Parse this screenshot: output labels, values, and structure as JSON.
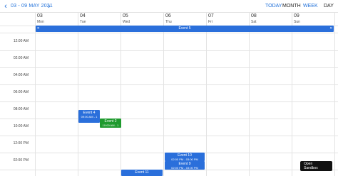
{
  "toolbar": {
    "prev_icon": "chevron-left-icon",
    "next_icon": "chevron-right-icon",
    "range": "03 - 09 MAY 2021",
    "today": "TODAY",
    "month": "MONTH",
    "week": "WEEK",
    "day": "DAY"
  },
  "days": [
    {
      "num": "03",
      "name": "Mon"
    },
    {
      "num": "04",
      "name": "Tue"
    },
    {
      "num": "05",
      "name": "Wed"
    },
    {
      "num": "06",
      "name": "Thu"
    },
    {
      "num": "07",
      "name": "Fri"
    },
    {
      "num": "08",
      "name": "Sat"
    },
    {
      "num": "09",
      "name": "Sun"
    }
  ],
  "allday": {
    "label": "Event 5",
    "left_icon": "chevron-left-icon",
    "right_icon": "chevron-right-icon"
  },
  "times": [
    "12:00 AM",
    "02:00 AM",
    "04:00 AM",
    "06:00 AM",
    "08:00 AM",
    "10:00 AM",
    "12:00 PM",
    "02:00 PM"
  ],
  "events": {
    "e4": {
      "title": "Event 4",
      "time": "09:00 AM - 1"
    },
    "e2": {
      "title": "Event 2",
      "time": "10:00 AM - 1"
    },
    "e10": {
      "title": "Event 10",
      "time": "02:00 PM - 03:00 PM"
    },
    "e9": {
      "title": "Event 9",
      "time": "02:00 PM - 03:00 PM"
    },
    "e11": {
      "title": "Event 11"
    }
  },
  "colors": {
    "accent": "#1e6fd9",
    "event_blue": "#2a6fdb",
    "event_green": "#1f9a2e",
    "sandbox": "#111111"
  },
  "sandbox": {
    "line1": "Open",
    "line2": "Sandbox"
  }
}
